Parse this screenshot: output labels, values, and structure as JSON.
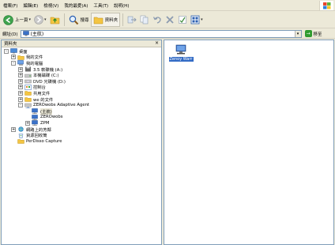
{
  "menubar": {
    "items": [
      "檔案(F)",
      "編輯(E)",
      "檢視(V)",
      "我的最愛(A)",
      "工具(T)",
      "說明(H)"
    ]
  },
  "toolbar": {
    "back_label": "上一頁",
    "search_label": "搜尋",
    "folders_label": "資料夾"
  },
  "addressbar": {
    "label": "網址(D)",
    "value": "(主航)",
    "go_label": "移至"
  },
  "folderpane": {
    "title": "資料夾",
    "close_glyph": "×"
  },
  "tree": [
    {
      "label": "桌面",
      "depth": 0,
      "expander": "-",
      "icon": "desktop-icon"
    },
    {
      "label": "我的文件",
      "depth": 1,
      "expander": "+",
      "icon": "folder-icon"
    },
    {
      "label": "我的電腦",
      "depth": 1,
      "expander": "-",
      "icon": "computer-icon"
    },
    {
      "label": "3.5 軟碟機 (A:)",
      "depth": 2,
      "expander": "+",
      "icon": "floppy-icon"
    },
    {
      "label": "本機磁碟 (C:)",
      "depth": 2,
      "expander": "+",
      "icon": "harddisk-icon"
    },
    {
      "label": "DVD 光碟機 (D:)",
      "depth": 2,
      "expander": "+",
      "icon": "dvd-icon"
    },
    {
      "label": "控制台",
      "depth": 2,
      "expander": "+",
      "icon": "control-panel-icon"
    },
    {
      "label": "共用文件",
      "depth": 2,
      "expander": "+",
      "icon": "folder-icon"
    },
    {
      "label": "we 的文件",
      "depth": 2,
      "expander": "+",
      "icon": "folder-icon"
    },
    {
      "label": "ZEROwobs Adaptive Agent",
      "depth": 2,
      "expander": "-",
      "icon": "network-drive-icon"
    },
    {
      "label": "(主航)",
      "depth": 3,
      "expander": "",
      "icon": "network-computer-icon",
      "selected": true
    },
    {
      "label": "ZEROwobs",
      "depth": 3,
      "expander": "",
      "icon": "network-computer-icon"
    },
    {
      "label": "ZPM",
      "depth": 3,
      "expander": "+",
      "icon": "network-computer-icon"
    },
    {
      "label": "網路上的芳鄰",
      "depth": 1,
      "expander": "+",
      "icon": "network-places-icon"
    },
    {
      "label": "資源回收筒",
      "depth": 1,
      "expander": "",
      "icon": "recycle-bin-icon"
    },
    {
      "label": "PerDisso Capture",
      "depth": 1,
      "expander": "",
      "icon": "folder-icon"
    }
  ],
  "content": {
    "items": [
      {
        "label": "Zenoy Warr",
        "icon": "network-share-icon"
      }
    ]
  },
  "colors": {
    "chrome": "#ece9d8",
    "selection": "#316ac5",
    "border": "#7f9db9"
  }
}
